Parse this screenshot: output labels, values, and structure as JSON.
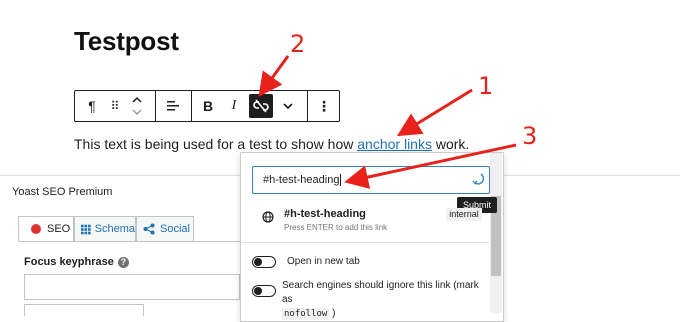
{
  "post": {
    "title": "Testpost",
    "paragraph_before": "This text is being used for a test to show how ",
    "paragraph_link": "anchor links",
    "paragraph_after": " work."
  },
  "toolbar": {
    "paragraph_icon": "¶",
    "drag_icon": "⠿",
    "align_icon": "≡",
    "bold_label": "B",
    "italic_label": "I",
    "link_icon": "unlink-icon",
    "more_rich_icon": "⌄",
    "options_icon": "⋮"
  },
  "link_popover": {
    "input_value": "#h-test-heading",
    "submit_tooltip": "Submit",
    "suggestion": {
      "title": "#h-test-heading",
      "subtitle": "Press ENTER to add this link",
      "badge": "internal"
    },
    "option_new_tab": "Open in new tab",
    "option_nofollow": "Search engines should ignore this link (mark as",
    "option_nofollow_code": "nofollow",
    "option_nofollow_end": ")"
  },
  "yoast": {
    "panel_title": "Yoast SEO Premium",
    "tabs": [
      {
        "label": "SEO"
      },
      {
        "label": "Schema"
      },
      {
        "label": "Social"
      }
    ],
    "focus_keyphrase_label": "Focus keyphrase",
    "help_glyph": "?"
  },
  "annotations": {
    "one": "1",
    "two": "2",
    "three": "3",
    "color": "#e8221b"
  },
  "colors": {
    "link": "#2271b1",
    "focus": "#3582c4",
    "seo_dot": "#dc3232"
  }
}
